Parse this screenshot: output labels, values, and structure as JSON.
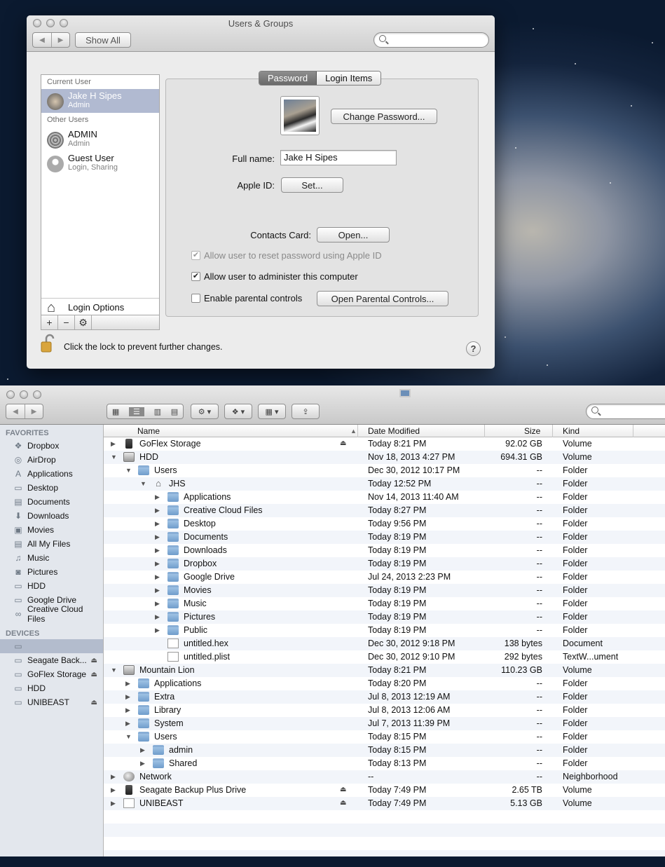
{
  "users_window": {
    "title": "Users & Groups",
    "show_all": "Show All",
    "search_placeholder": "",
    "tabs": [
      "Password",
      "Login Items"
    ],
    "current_user_header": "Current User",
    "other_users_header": "Other Users",
    "users": [
      {
        "name": "Jake H Sipes",
        "role": "Admin"
      },
      {
        "name": "ADMIN",
        "role": "Admin"
      },
      {
        "name": "Guest User",
        "role": "Login, Sharing"
      }
    ],
    "login_options": "Login Options",
    "list_buttons": [
      "+",
      "−",
      "⚙"
    ],
    "change_password": "Change Password...",
    "full_name_label": "Full name:",
    "full_name_value": "Jake H Sipes",
    "apple_id_label": "Apple ID:",
    "apple_id_button": "Set...",
    "contacts_label": "Contacts Card:",
    "contacts_button": "Open...",
    "checkboxes": [
      {
        "label": "Allow user to reset password using Apple ID",
        "checked": true,
        "disabled": true
      },
      {
        "label": "Allow user to administer this computer",
        "checked": true,
        "disabled": false
      },
      {
        "label": "Enable parental controls",
        "checked": false,
        "disabled": false
      }
    ],
    "parental_button": "Open Parental Controls...",
    "lock_text": "Click the lock to prevent further changes.",
    "help": "?"
  },
  "finder": {
    "sidebar": {
      "favorites_header": "FAVORITES",
      "favorites": [
        {
          "label": "Dropbox",
          "icon": "dropbox-icon"
        },
        {
          "label": "AirDrop",
          "icon": "airdrop-icon"
        },
        {
          "label": "Applications",
          "icon": "applications-icon"
        },
        {
          "label": "Desktop",
          "icon": "desktop-icon"
        },
        {
          "label": "Documents",
          "icon": "documents-icon"
        },
        {
          "label": "Downloads",
          "icon": "downloads-icon"
        },
        {
          "label": "Movies",
          "icon": "movies-icon"
        },
        {
          "label": "All My Files",
          "icon": "all-files-icon"
        },
        {
          "label": "Music",
          "icon": "music-icon"
        },
        {
          "label": "Pictures",
          "icon": "pictures-icon"
        },
        {
          "label": "HDD",
          "icon": "hdd-icon"
        },
        {
          "label": "Google Drive",
          "icon": "folder-icon"
        },
        {
          "label": "Creative Cloud Files",
          "icon": "creative-cloud-icon"
        }
      ],
      "devices_header": "DEVICES",
      "devices": [
        {
          "label": "",
          "icon": "computer-icon",
          "eject": false
        },
        {
          "label": "Seagate Back...",
          "icon": "drive-icon",
          "eject": true
        },
        {
          "label": "GoFlex Storage",
          "icon": "drive-icon",
          "eject": true
        },
        {
          "label": "HDD",
          "icon": "drive-icon",
          "eject": false
        },
        {
          "label": "UNIBEAST",
          "icon": "drive-icon",
          "eject": true
        }
      ]
    },
    "columns": [
      "Name",
      "Date Modified",
      "Size",
      "Kind"
    ],
    "rows": [
      {
        "indent": 0,
        "tri": "▶",
        "icon": "drive",
        "name": "GoFlex Storage",
        "eject": true,
        "date": "Today 8:21 PM",
        "size": "92.02 GB",
        "kind": "Volume"
      },
      {
        "indent": 0,
        "tri": "▼",
        "icon": "hdd",
        "name": "HDD",
        "eject": false,
        "date": "Nov 18, 2013 4:27 PM",
        "size": "694.31 GB",
        "kind": "Volume"
      },
      {
        "indent": 1,
        "tri": "▼",
        "icon": "folder",
        "name": "Users",
        "eject": false,
        "date": "Dec 30, 2012 10:17 PM",
        "size": "--",
        "kind": "Folder"
      },
      {
        "indent": 2,
        "tri": "▼",
        "icon": "home",
        "name": "JHS",
        "eject": false,
        "date": "Today 12:52 PM",
        "size": "--",
        "kind": "Folder"
      },
      {
        "indent": 3,
        "tri": "▶",
        "icon": "folder",
        "name": "Applications",
        "eject": false,
        "date": "Nov 14, 2013 11:40 AM",
        "size": "--",
        "kind": "Folder"
      },
      {
        "indent": 3,
        "tri": "▶",
        "icon": "folder",
        "name": "Creative Cloud Files",
        "eject": false,
        "date": "Today 8:27 PM",
        "size": "--",
        "kind": "Folder"
      },
      {
        "indent": 3,
        "tri": "▶",
        "icon": "folder",
        "name": "Desktop",
        "eject": false,
        "date": "Today 9:56 PM",
        "size": "--",
        "kind": "Folder"
      },
      {
        "indent": 3,
        "tri": "▶",
        "icon": "folder",
        "name": "Documents",
        "eject": false,
        "date": "Today 8:19 PM",
        "size": "--",
        "kind": "Folder"
      },
      {
        "indent": 3,
        "tri": "▶",
        "icon": "folder",
        "name": "Downloads",
        "eject": false,
        "date": "Today 8:19 PM",
        "size": "--",
        "kind": "Folder"
      },
      {
        "indent": 3,
        "tri": "▶",
        "icon": "folder",
        "name": "Dropbox",
        "eject": false,
        "date": "Today 8:19 PM",
        "size": "--",
        "kind": "Folder"
      },
      {
        "indent": 3,
        "tri": "▶",
        "icon": "folder",
        "name": "Google Drive",
        "eject": false,
        "date": "Jul 24, 2013 2:23 PM",
        "size": "--",
        "kind": "Folder"
      },
      {
        "indent": 3,
        "tri": "▶",
        "icon": "folder",
        "name": "Movies",
        "eject": false,
        "date": "Today 8:19 PM",
        "size": "--",
        "kind": "Folder"
      },
      {
        "indent": 3,
        "tri": "▶",
        "icon": "folder",
        "name": "Music",
        "eject": false,
        "date": "Today 8:19 PM",
        "size": "--",
        "kind": "Folder"
      },
      {
        "indent": 3,
        "tri": "▶",
        "icon": "folder",
        "name": "Pictures",
        "eject": false,
        "date": "Today 8:19 PM",
        "size": "--",
        "kind": "Folder"
      },
      {
        "indent": 3,
        "tri": "▶",
        "icon": "folder",
        "name": "Public",
        "eject": false,
        "date": "Today 8:19 PM",
        "size": "--",
        "kind": "Folder"
      },
      {
        "indent": 3,
        "tri": "",
        "icon": "doc",
        "name": "untitled.hex",
        "eject": false,
        "date": "Dec 30, 2012 9:18 PM",
        "size": "138 bytes",
        "kind": "Document"
      },
      {
        "indent": 3,
        "tri": "",
        "icon": "doc",
        "name": "untitled.plist",
        "eject": false,
        "date": "Dec 30, 2012 9:10 PM",
        "size": "292 bytes",
        "kind": "TextW...ument"
      },
      {
        "indent": 0,
        "tri": "▼",
        "icon": "hdd",
        "name": "Mountain Lion",
        "eject": false,
        "date": "Today 8:21 PM",
        "size": "110.23 GB",
        "kind": "Volume"
      },
      {
        "indent": 1,
        "tri": "▶",
        "icon": "folder",
        "name": "Applications",
        "eject": false,
        "date": "Today 8:20 PM",
        "size": "--",
        "kind": "Folder"
      },
      {
        "indent": 1,
        "tri": "▶",
        "icon": "folder",
        "name": "Extra",
        "eject": false,
        "date": "Jul 8, 2013 12:19 AM",
        "size": "--",
        "kind": "Folder"
      },
      {
        "indent": 1,
        "tri": "▶",
        "icon": "folder",
        "name": "Library",
        "eject": false,
        "date": "Jul 8, 2013 12:06 AM",
        "size": "--",
        "kind": "Folder"
      },
      {
        "indent": 1,
        "tri": "▶",
        "icon": "folder",
        "name": "System",
        "eject": false,
        "date": "Jul 7, 2013 11:39 PM",
        "size": "--",
        "kind": "Folder"
      },
      {
        "indent": 1,
        "tri": "▼",
        "icon": "folder",
        "name": "Users",
        "eject": false,
        "date": "Today 8:15 PM",
        "size": "--",
        "kind": "Folder"
      },
      {
        "indent": 2,
        "tri": "▶",
        "icon": "folder",
        "name": "admin",
        "eject": false,
        "date": "Today 8:15 PM",
        "size": "--",
        "kind": "Folder"
      },
      {
        "indent": 2,
        "tri": "▶",
        "icon": "folder",
        "name": "Shared",
        "eject": false,
        "date": "Today 8:13 PM",
        "size": "--",
        "kind": "Folder"
      },
      {
        "indent": 0,
        "tri": "▶",
        "icon": "globe",
        "name": "Network",
        "eject": false,
        "date": "--",
        "size": "--",
        "kind": "Neighborhood"
      },
      {
        "indent": 0,
        "tri": "▶",
        "icon": "drive",
        "name": "Seagate Backup Plus Drive",
        "eject": true,
        "date": "Today 7:49 PM",
        "size": "2.65 TB",
        "kind": "Volume"
      },
      {
        "indent": 0,
        "tri": "▶",
        "icon": "doc",
        "name": "UNIBEAST",
        "eject": true,
        "date": "Today 7:49 PM",
        "size": "5.13 GB",
        "kind": "Volume"
      }
    ]
  }
}
